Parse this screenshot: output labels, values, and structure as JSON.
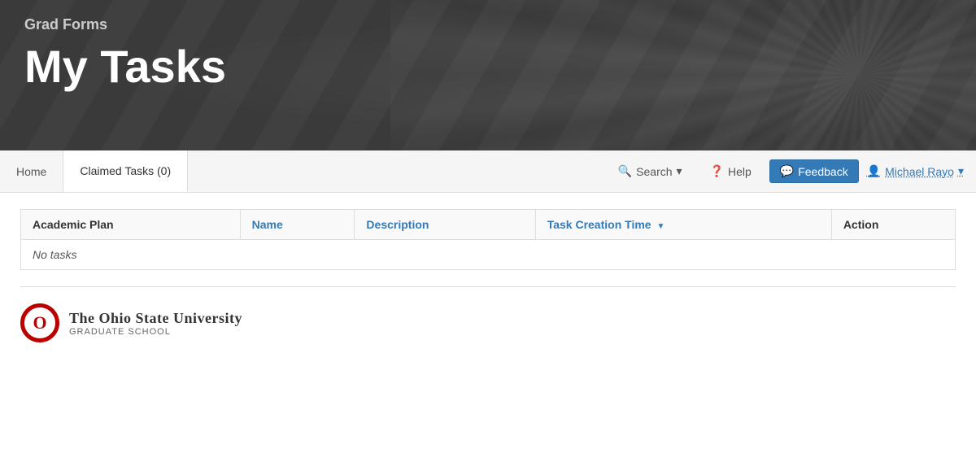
{
  "header": {
    "app_name": "Grad Forms",
    "page_title": "My Tasks"
  },
  "navbar": {
    "home_label": "Home",
    "claimed_tasks_label": "Claimed Tasks (0)",
    "search_label": "Search",
    "help_label": "Help",
    "feedback_label": "Feedback",
    "user_label": "Michael Rayo",
    "search_icon": "🔍",
    "help_icon": "❓",
    "feedback_icon": "💬",
    "user_icon": "👤",
    "dropdown_arrow": "▾"
  },
  "table": {
    "columns": [
      {
        "key": "academic_plan",
        "label": "Academic Plan",
        "sortable": false
      },
      {
        "key": "name",
        "label": "Name",
        "sortable": true
      },
      {
        "key": "description",
        "label": "Description",
        "sortable": true
      },
      {
        "key": "task_creation_time",
        "label": "Task Creation Time",
        "sortable": true,
        "active_sort": true
      },
      {
        "key": "action",
        "label": "Action",
        "sortable": false
      }
    ],
    "empty_message": "No tasks"
  },
  "footer": {
    "university_name": "The Ohio State University",
    "school_name": "Graduate School",
    "logo_letter": "O"
  }
}
